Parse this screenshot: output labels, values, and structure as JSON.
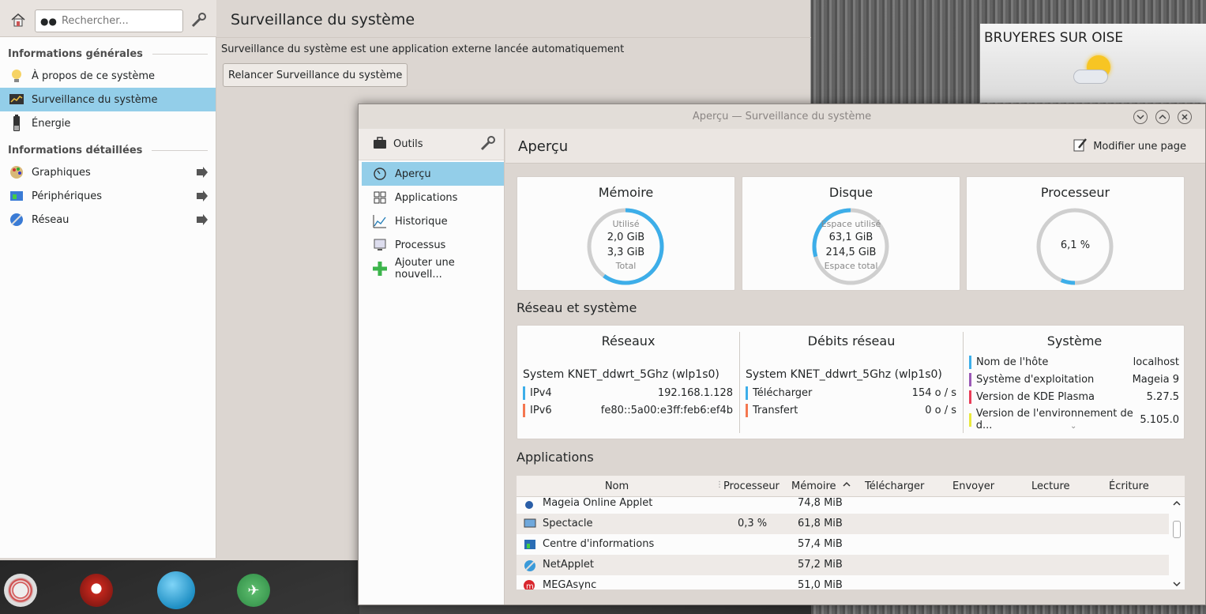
{
  "info_center": {
    "search_placeholder": "Rechercher...",
    "title": "Surveillance du système",
    "text": "Surveillance du système est une application externe lancée automatiquement",
    "relaunch_button": "Relancer Surveillance du système",
    "sections": [
      {
        "title": "Informations générales",
        "items": [
          {
            "label": "À propos de ce système",
            "icon": "lightbulb-icon"
          },
          {
            "label": "Surveillance du système",
            "icon": "monitor-chart-icon",
            "selected": true
          },
          {
            "label": "Énergie",
            "icon": "battery-icon"
          }
        ]
      },
      {
        "title": "Informations détaillées",
        "items": [
          {
            "label": "Graphiques",
            "icon": "palette-icon"
          },
          {
            "label": "Périphériques",
            "icon": "devices-icon"
          },
          {
            "label": "Réseau",
            "icon": "globe-network-icon"
          }
        ]
      }
    ]
  },
  "weather": {
    "city": "BRUYERES SUR OISE"
  },
  "monitor": {
    "window_title": "Aperçu — Surveillance du système",
    "tools_label": "Outils",
    "nav": [
      "Aperçu",
      "Applications",
      "Historique",
      "Processus",
      "Ajouter une nouvell..."
    ],
    "page_title": "Aperçu",
    "edit_button": "Modifier une page",
    "memory": {
      "title": "Mémoire",
      "label_top": "Utilisé",
      "used": "2,0 GiB",
      "total": "3,3 GiB",
      "label_bottom": "Total",
      "fraction": 0.6
    },
    "disk": {
      "title": "Disque",
      "label_top": "Espace utilisé",
      "used": "63,1 GiB",
      "total": "214,5 GiB",
      "label_bottom": "Espace total",
      "fraction": 0.294
    },
    "cpu": {
      "title": "Processeur",
      "value": "6,1 %",
      "fraction": 0.061
    },
    "network_section": "Réseau et système",
    "networks": {
      "title": "Réseaux",
      "iface": "System KNET_ddwrt_5Ghz (wlp1s0)",
      "rows": [
        {
          "label": "IPv4",
          "value": "192.168.1.128",
          "color": "#3daee9"
        },
        {
          "label": "IPv6",
          "value": "fe80::5a00:e3ff:feb6:ef4b",
          "color": "#f47750"
        }
      ]
    },
    "rates": {
      "title": "Débits réseau",
      "iface": "System KNET_ddwrt_5Ghz (wlp1s0)",
      "rows": [
        {
          "label": "Télécharger",
          "value": "154 o / s",
          "color": "#3daee9"
        },
        {
          "label": "Transfert",
          "value": "0 o / s",
          "color": "#f47750"
        }
      ]
    },
    "system": {
      "title": "Système",
      "rows": [
        {
          "label": "Nom de l'hôte",
          "value": "localhost",
          "color": "#3daee9"
        },
        {
          "label": "Système d'exploitation",
          "value": "Mageia 9",
          "color": "#9b59b6"
        },
        {
          "label": "Version de KDE Plasma",
          "value": "5.27.5",
          "color": "#e93d58"
        },
        {
          "label": "Version de l'environnement de d...",
          "value": "5.105.0",
          "color": "#e9e93d"
        }
      ]
    },
    "apps_section": "Applications",
    "columns": [
      "Nom",
      "Processeur",
      "Mémoire",
      "Télécharger",
      "Envoyer",
      "Lecture",
      "Écriture"
    ],
    "apps": [
      {
        "name": "Mageia Online Applet",
        "cpu": "",
        "mem": "74,8 MiB",
        "icon": "mageia-icon"
      },
      {
        "name": "Spectacle",
        "cpu": "0,3 %",
        "mem": "61,8 MiB",
        "icon": "spectacle-icon"
      },
      {
        "name": "Centre d'informations",
        "cpu": "",
        "mem": "57,4 MiB",
        "icon": "info-center-icon"
      },
      {
        "name": "NetApplet",
        "cpu": "",
        "mem": "57,2 MiB",
        "icon": "network-applet-icon"
      },
      {
        "name": "MEGAsync",
        "cpu": "",
        "mem": "51,0 MiB",
        "icon": "mega-icon"
      }
    ]
  }
}
